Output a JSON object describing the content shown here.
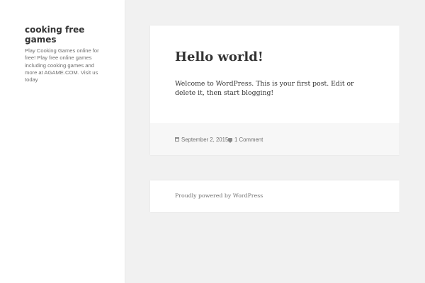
{
  "sidebar": {
    "site_title": "cooking free games",
    "site_description": "Play Cooking Games online for free! Play free online games including cooking games and more at AGAME.COM. Visit us today"
  },
  "post": {
    "title": "Hello world!",
    "content": "Welcome to WordPress. This is your first post. Edit or delete it, then start blogging!",
    "meta": {
      "date": "September 2, 2015",
      "comments": "1 Comment",
      "date_icon": "calendar-icon",
      "comments_icon": "comment-icon"
    }
  },
  "footer": {
    "credit": "Proudly powered by WordPress"
  },
  "colors": {
    "page_background": "#f1f1f1",
    "panel_background": "#ffffff",
    "entry_footer_background": "#f7f7f7",
    "text_primary": "#333333",
    "text_secondary": "#707070"
  }
}
